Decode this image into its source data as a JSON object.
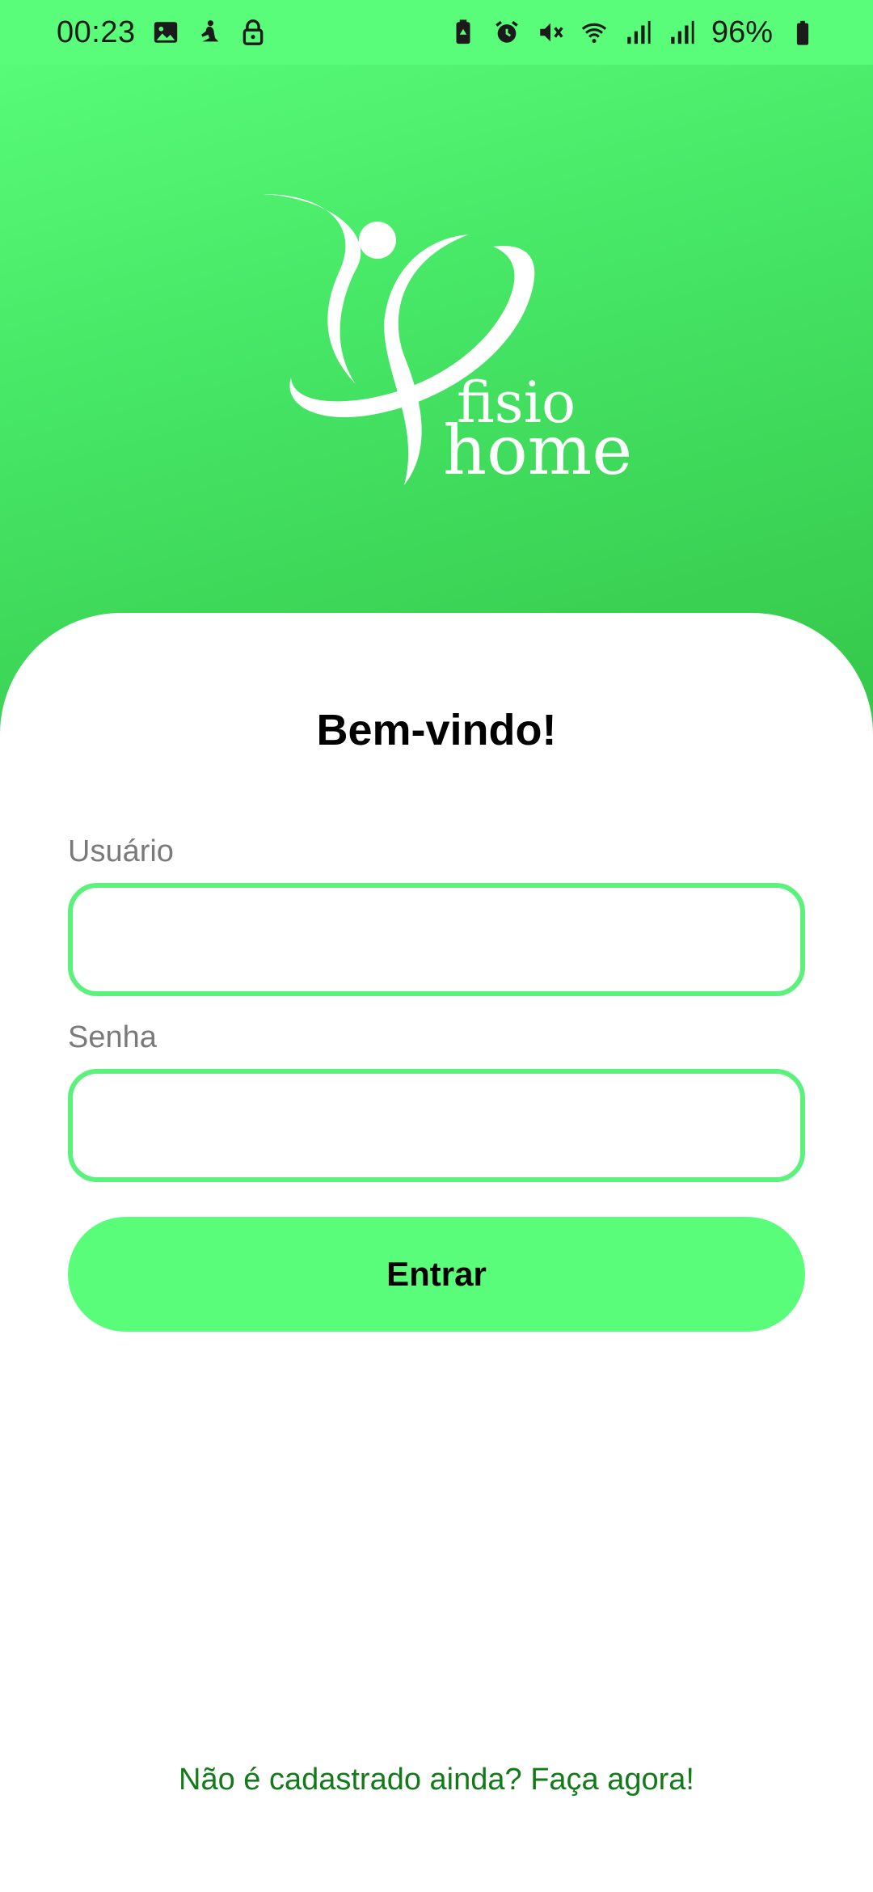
{
  "status_bar": {
    "time": "00:23",
    "left_icons": [
      "image-icon",
      "meditation-icon",
      "lock-icon"
    ],
    "right_icons": [
      "battery-saver-icon",
      "alarm-icon",
      "mute-icon",
      "wifi-icon",
      "signal-icon",
      "signal-icon"
    ],
    "battery": "96%"
  },
  "logo": {
    "line1": "fisio",
    "line2": "home"
  },
  "login": {
    "title": "Bem-vindo!",
    "username_label": "Usuário",
    "username_value": "",
    "password_label": "Senha",
    "password_value": "",
    "submit_label": "Entrar",
    "signup_link": "Não é cadastrado ainda? Faça agora!"
  },
  "colors": {
    "accent": "#59fd79",
    "field_border": "#5cf17c",
    "link": "#137a19"
  }
}
